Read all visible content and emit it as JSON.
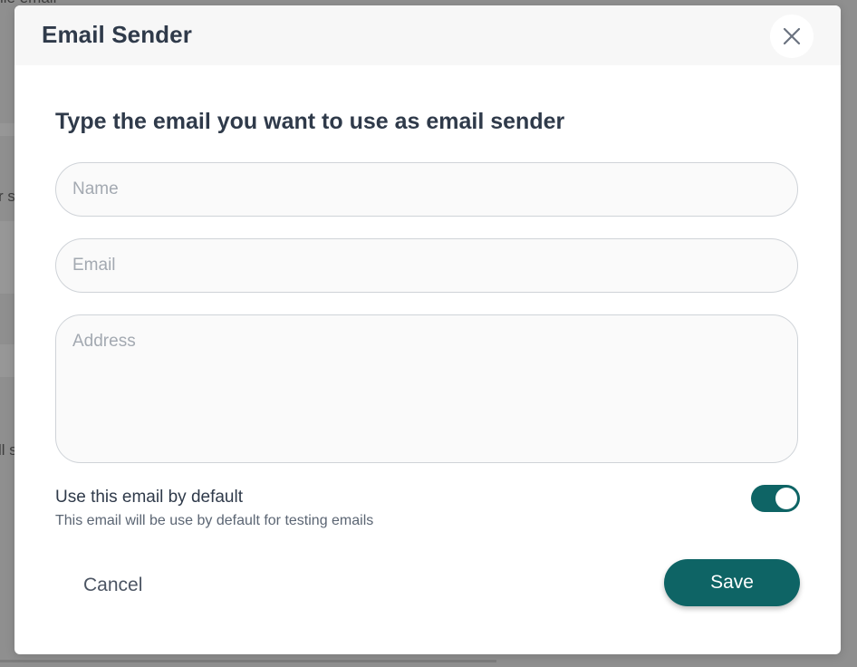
{
  "modal": {
    "title": "Email Sender",
    "subtitle": "Type the email you want to use as email sender"
  },
  "form": {
    "name_placeholder": "Name",
    "email_placeholder": "Email",
    "address_placeholder": "Address",
    "name_value": "",
    "email_value": "",
    "address_value": ""
  },
  "default_toggle": {
    "label": "Use this email by default",
    "description": "This email will be use by default for testing emails",
    "on": true
  },
  "actions": {
    "cancel_label": "Cancel",
    "save_label": "Save"
  },
  "colors": {
    "accent": "#0e6465",
    "heading": "#2f3a4a",
    "overlay": "#8f8f8f"
  },
  "icons": {
    "close": "close-icon"
  }
}
